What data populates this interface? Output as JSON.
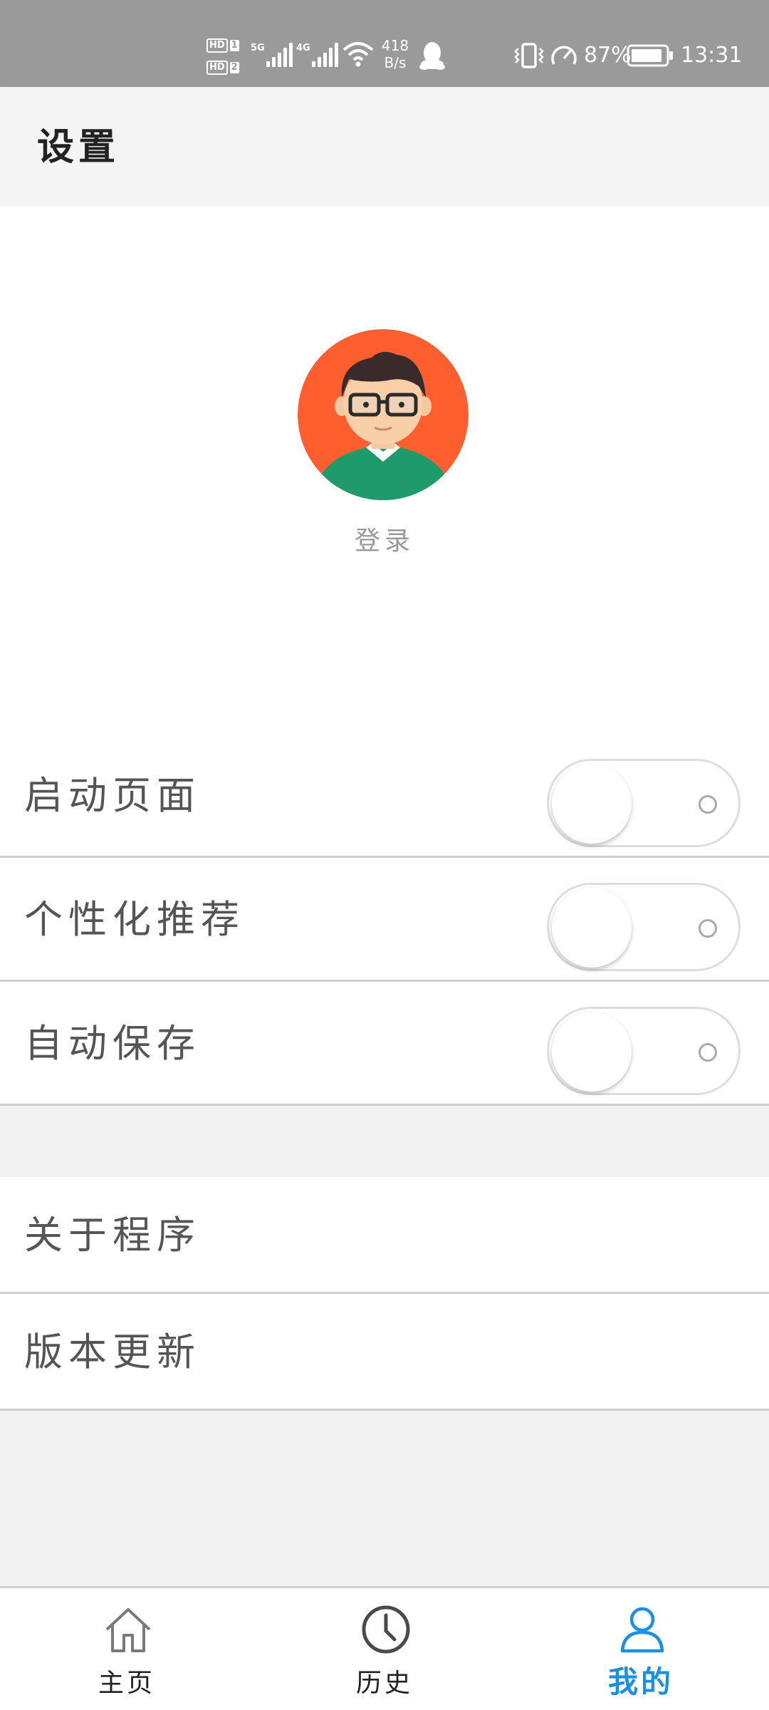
{
  "status_bar": {
    "hd1": "HD",
    "hd1_num": "1",
    "hd2": "HD",
    "hd2_num": "2",
    "sim1_type": "5G",
    "sim2_type": "4G",
    "net_speed_value": "418",
    "net_speed_unit": "B/s",
    "battery_percent": "87%",
    "time": "13:31",
    "icons": [
      "signal-icon",
      "wifi-icon",
      "qq-icon",
      "vibrate-icon",
      "speed-gauge-icon",
      "battery-icon"
    ]
  },
  "header": {
    "title": "设置"
  },
  "profile": {
    "login_label": "登录",
    "avatar": "avatar-cartoon-man-glasses"
  },
  "toggles": [
    {
      "label": "启动页面",
      "on": false
    },
    {
      "label": "个性化推荐",
      "on": false
    },
    {
      "label": "自动保存",
      "on": false
    }
  ],
  "links": [
    {
      "label": "关于程序"
    },
    {
      "label": "版本更新"
    }
  ],
  "bottom_nav": {
    "items": [
      {
        "label": "主页",
        "icon": "home-icon",
        "active": false
      },
      {
        "label": "历史",
        "icon": "clock-icon",
        "active": false
      },
      {
        "label": "我的",
        "icon": "user-icon",
        "active": true
      }
    ],
    "active_color": "#1d8fe0"
  },
  "colors": {
    "status_bar": "#9a9a9a",
    "header_bg": "#f4f4f4",
    "page_bg": "#f2f2f2",
    "avatar_bg": "#ff5e2e",
    "accent": "#1d8fe0"
  }
}
